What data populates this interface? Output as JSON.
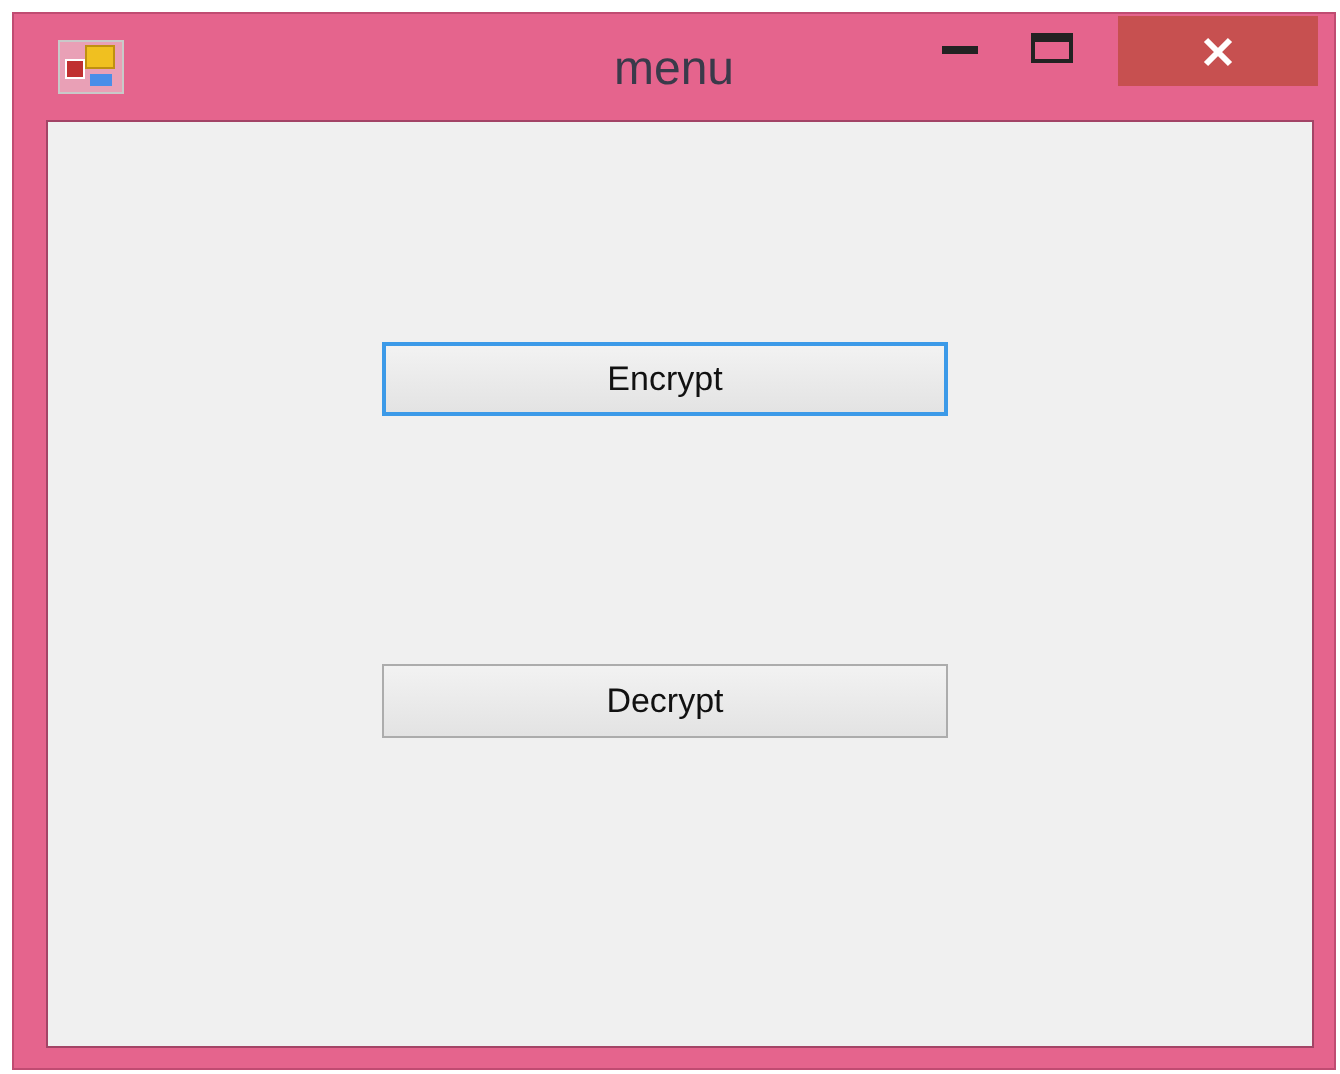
{
  "window": {
    "title": "menu"
  },
  "buttons": [
    {
      "label": "Encrypt",
      "focused": true
    },
    {
      "label": "Decrypt",
      "focused": false
    }
  ]
}
